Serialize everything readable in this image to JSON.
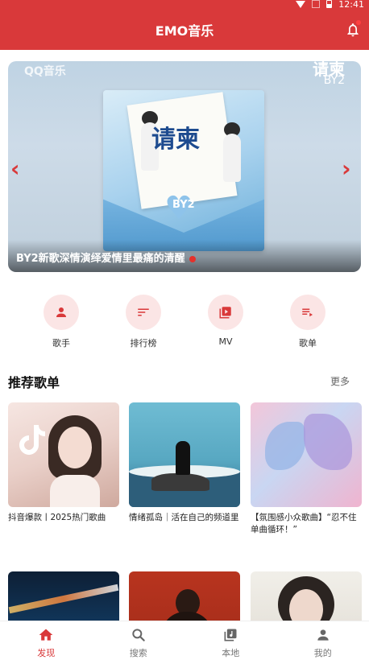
{
  "status_bar": {
    "time": "12:41"
  },
  "app_bar": {
    "title": "EMO音乐"
  },
  "banner": {
    "watermark": "QQ音乐",
    "corner_title": "请柬",
    "corner_sub": "BY2",
    "album_title": "请柬",
    "album_heart": "BY2",
    "caption": "BY2新歌深情演绎爱情里最痛的清醒"
  },
  "quick_actions": [
    {
      "label": "歌手",
      "icon": "person-icon"
    },
    {
      "label": "排行榜",
      "icon": "ranking-icon"
    },
    {
      "label": "MV",
      "icon": "video-icon"
    },
    {
      "label": "歌单",
      "icon": "playlist-icon"
    }
  ],
  "recommend": {
    "title": "推荐歌单",
    "more": "更多",
    "playlists": [
      {
        "name": "抖音爆款丨2025热门歌曲"
      },
      {
        "name": "情绪孤岛｜活在自己的频道里"
      },
      {
        "name": "【氛围感小众歌曲】“忍不住单曲循环！”"
      },
      {
        "name": ""
      },
      {
        "name": ""
      },
      {
        "name": ""
      }
    ]
  },
  "tabs": [
    {
      "label": "发现",
      "icon": "home-icon",
      "active": true
    },
    {
      "label": "搜索",
      "icon": "search-icon",
      "active": false
    },
    {
      "label": "本地",
      "icon": "music-library-icon",
      "active": false
    },
    {
      "label": "我的",
      "icon": "profile-icon",
      "active": false
    }
  ],
  "colors": {
    "primary": "#d9393a",
    "quick_bg": "#fbe5e5"
  }
}
